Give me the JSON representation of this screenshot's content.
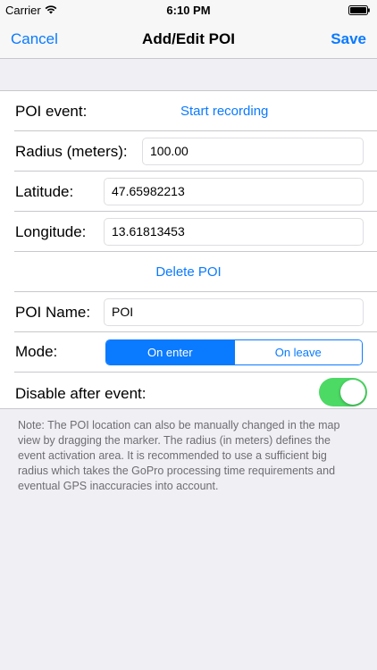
{
  "status_bar": {
    "carrier": "Carrier",
    "time": "6:10 PM",
    "wifi_icon": "wifi-icon",
    "battery_icon": "battery-icon"
  },
  "nav": {
    "cancel": "Cancel",
    "title": "Add/Edit POI",
    "save": "Save"
  },
  "form": {
    "poi_event": {
      "label": "POI event:",
      "action": "Start recording"
    },
    "radius": {
      "label": "Radius (meters):",
      "value": "100.00"
    },
    "latitude": {
      "label": "Latitude:",
      "value": "47.65982213"
    },
    "longitude": {
      "label": "Longitude:",
      "value": "13.61813453"
    },
    "delete_label": "Delete POI",
    "poi_name": {
      "label": "POI Name:",
      "value": "POI"
    },
    "mode": {
      "label": "Mode:",
      "options": [
        "On enter",
        "On leave"
      ],
      "selected": "On enter"
    },
    "disable_after": {
      "label": "Disable after event:",
      "enabled": true
    }
  },
  "note": "Note: The POI location can also be manually changed in the map view by dragging the marker. The radius (in meters) defines the event activation area. It is recommended to use a sufficient big radius which takes the GoPro processing time requirements and eventual GPS inaccuracies into account.",
  "colors": {
    "accent": "#0a7aff",
    "toggle_on": "#4cd964",
    "background": "#efeff4"
  }
}
